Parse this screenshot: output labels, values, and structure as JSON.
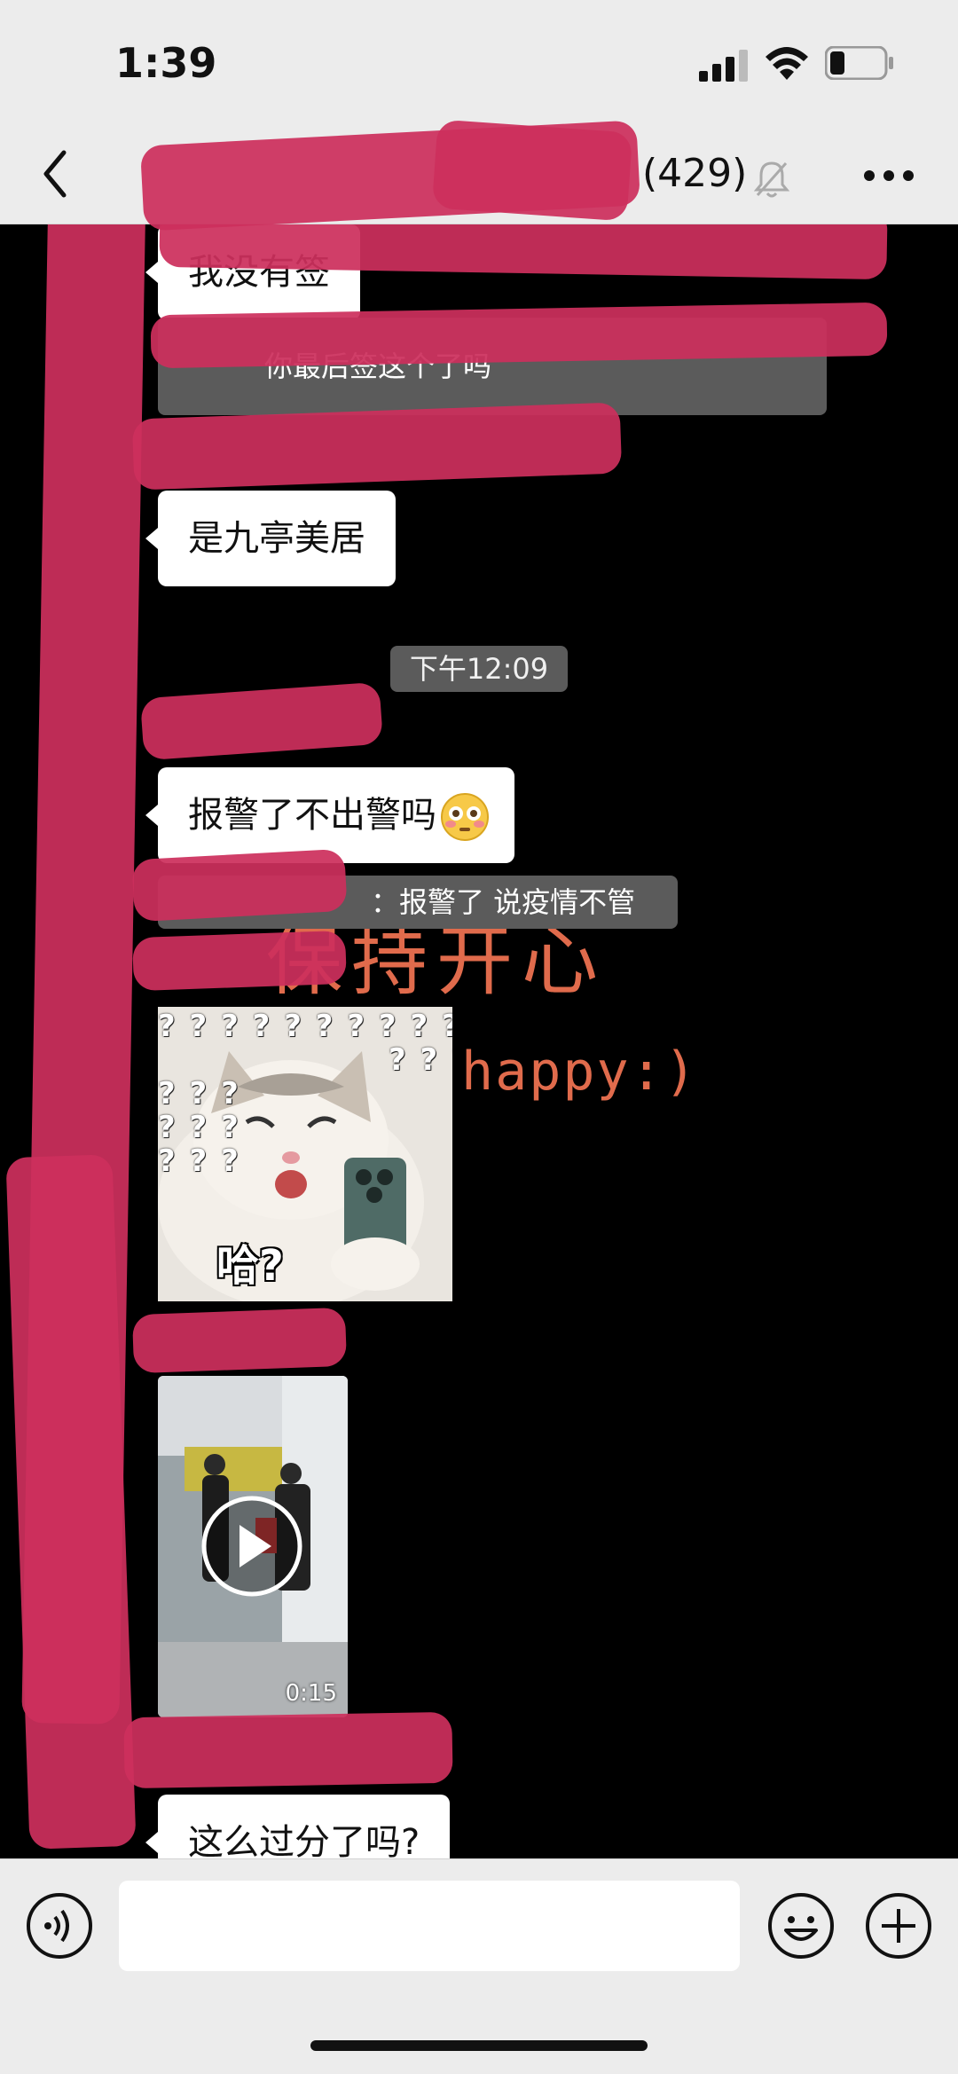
{
  "status_bar": {
    "time": "1:39"
  },
  "header": {
    "member_count": "(429)"
  },
  "messages": {
    "m1": "我没有签",
    "m1_quote": "你最后签这个了吗",
    "m2": "是九亭美居",
    "timestamp": "下午12:09",
    "m3": "报警了不出警吗",
    "m3_quote": "：报警了 说疫情不管",
    "sticker_question_marks": "? ? ? ? ? ? ? ? ? ? ?",
    "sticker_caption": "哈?",
    "video_duration": "0:15",
    "m4": "这么过分了吗?"
  },
  "wallpaper": {
    "line1": "保持开心",
    "line2": "happy:)"
  },
  "input": {
    "placeholder": ""
  },
  "colors": {
    "redaction": "#cc2f5d",
    "wallpaper_text": "#ff7a57",
    "quote_bg": "#5b5b5b"
  }
}
